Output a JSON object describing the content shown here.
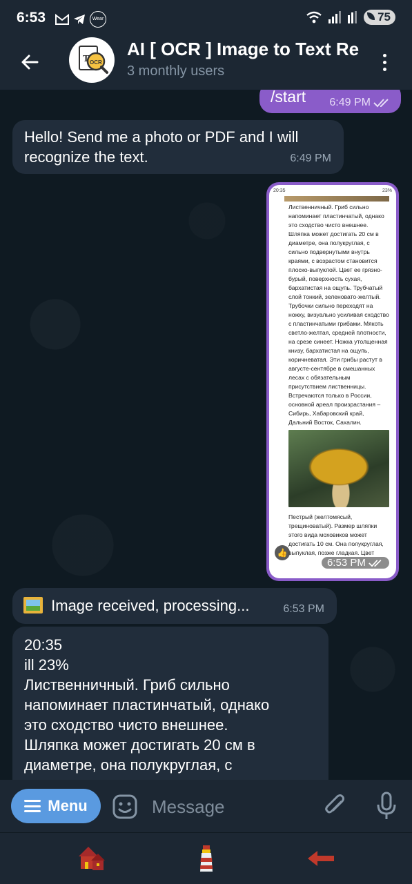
{
  "status_bar": {
    "time": "6:53",
    "wear_label": "Wear",
    "battery": "75"
  },
  "header": {
    "title": "AI [ OCR ] Image to Text Re",
    "subtitle": "3 monthly users",
    "avatar_text": "OCR"
  },
  "messages": {
    "start_cmd": {
      "text": "/start",
      "time": "6:49 PM"
    },
    "greeting": {
      "text": "Hello! Send me a photo or PDF and I will recognize the text.",
      "time": "6:49 PM"
    },
    "photo": {
      "time": "6:53 PM",
      "status_time": "20:35",
      "status_battery": "23%",
      "para1": "Лиственничный. Гриб сильно напоминает пластинчатый, однако это сходство чисто внешнее. Шляпка может достигать 20 см в диаметре, она полукруглая, с сильно подвернутыми внутрь краями, с возрастом становится плоско-выпуклой. Цвет ее грязно-бурый, поверхность сухая, бархатистая на ощупь. Трубчатый слой тонкий, зеленовато-желтый. Трубочки сильно переходят на ножку, визуально усиливая сходство с пластинчатыми грибами. Мякоть светло-желтая, средней плотности, на срезе синеет. Ножка утолщенная книзу, бархатистая на ощупь, коричневатая. Эти грибы растут в августе-сентябре в смешанных лесах с обязательным присутствием лиственницы. Встречаются только в России, основной ареал произрастания – Сибирь, Хабаровский край, Дальний Восток, Сахалин.",
      "para2": "Пестрый (желтомясый, трещиноватый). Размер шляпки этого вида моховиков может достигать 10 см. Она полукруглая, выпуклая, позже гладкая. Цвет"
    },
    "received": {
      "text": "Image received, processing...",
      "time": "6:53 PM"
    },
    "ocr_result": {
      "lines": [
        "20:35",
        "ill 23%",
        "Лиственничный. Гриб сильно",
        "напоминает пластинчатый, однако",
        "это сходство чисто внешнее.",
        "Шляпка может достигать 20 см в",
        "диаметре, она полукруглая, с"
      ]
    }
  },
  "input_bar": {
    "menu_label": "Menu",
    "message_placeholder": "Message"
  },
  "colors": {
    "outgoing_bubble": "#8a5cc9",
    "incoming_bubble": "#212d3b",
    "menu_button": "#5a9ae0",
    "bar_bg": "#1c2733"
  }
}
